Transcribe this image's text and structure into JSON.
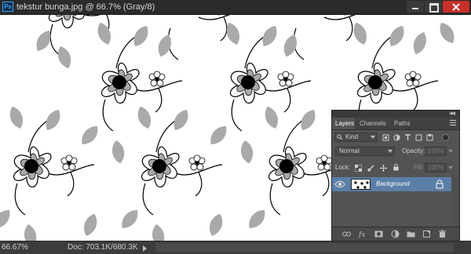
{
  "app": {
    "icon_text": "Ps"
  },
  "document": {
    "title": "tekstur bunga.jpg @ 66.7% (Gray/8)"
  },
  "window_controls": [
    "minimize-button",
    "maximize-button",
    "close-button"
  ],
  "status": {
    "zoom": "66.67%",
    "doc_info": "Doc: 703.1K/680.3K"
  },
  "layers_panel": {
    "tabs": [
      {
        "label": "Layers",
        "active": true
      },
      {
        "label": "Channels",
        "active": false
      },
      {
        "label": "Paths",
        "active": false
      }
    ],
    "filter": {
      "label": "Kind"
    },
    "blend_mode": "Normal",
    "opacity_label": "Opacity:",
    "opacity_value": "100%",
    "lock_label": "Lock:",
    "fill_label": "Fill:",
    "fill_value": "100%",
    "layers": [
      {
        "name": "Background",
        "visible": true,
        "locked": true
      }
    ],
    "footer_buttons": [
      "link-icon",
      "fx-icon",
      "mask-icon",
      "adjustment-icon",
      "folder-icon",
      "new-layer-icon",
      "trash-icon"
    ]
  },
  "colors": {
    "accent": "#5a7fa8",
    "panel_bg": "#535353",
    "title_bar": "#2b2b2b",
    "close": "#c7312a"
  }
}
